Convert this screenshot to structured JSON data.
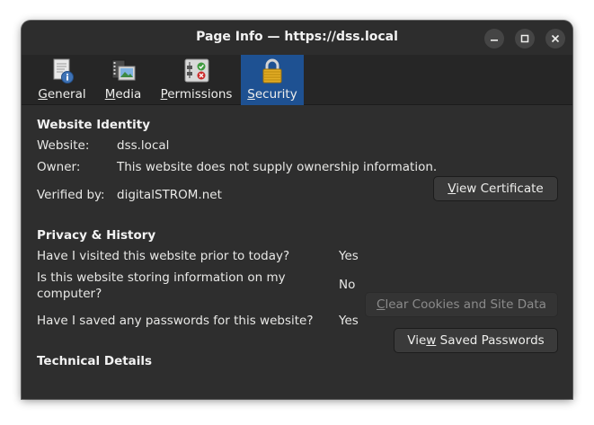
{
  "window": {
    "title": "Page Info — https://dss.local"
  },
  "tabs": [
    {
      "label": "General",
      "icon": "document-info-icon",
      "active": false
    },
    {
      "label": "Media",
      "icon": "media-film-icon",
      "active": false
    },
    {
      "label": "Permissions",
      "icon": "permissions-toggles-icon",
      "active": false
    },
    {
      "label": "Security",
      "icon": "padlock-icon",
      "active": true
    }
  ],
  "identity": {
    "heading": "Website Identity",
    "website_label": "Website:",
    "website_value": "dss.local",
    "owner_label": "Owner:",
    "owner_value": "This website does not supply ownership information.",
    "verified_label": "Verified by:",
    "verified_value": "digitalSTROM.net",
    "view_certificate_button": "View Certificate"
  },
  "privacy": {
    "heading": "Privacy & History",
    "q_visited": "Have I visited this website prior to today?",
    "a_visited": "Yes",
    "q_storing_line1": "Is this website storing information on my",
    "q_storing_line2": "computer?",
    "a_storing": "No",
    "clear_cookies_button": "Clear Cookies and Site Data",
    "q_passwords": "Have I saved any passwords for this website?",
    "a_passwords": "Yes",
    "view_passwords_button": "View Saved Passwords"
  },
  "technical": {
    "heading": "Technical Details"
  },
  "colors": {
    "window_bg": "#2e2e2e",
    "active_tab": "#1e5192",
    "text": "#eeeeec"
  }
}
